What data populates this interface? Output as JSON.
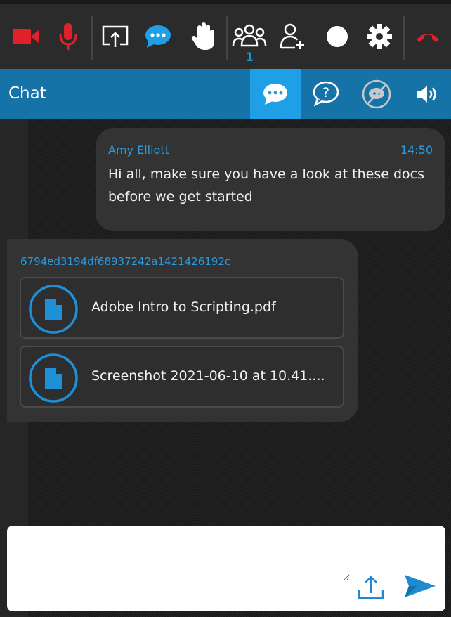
{
  "toolbar": {
    "participant_count": "1"
  },
  "chat_header": {
    "title": "Chat"
  },
  "messages": [
    {
      "sender": "Amy Elliott",
      "time": "14:50",
      "text": "Hi all, make sure you have a look at these docs before we get started"
    },
    {
      "sender": "6794ed3194df68937242a1421426192c",
      "files": [
        {
          "name": "Adobe Intro to Scripting.pdf"
        },
        {
          "name": "Screenshot 2021-06-10 at 10.41...."
        }
      ]
    }
  ],
  "composer": {
    "placeholder": ""
  },
  "colors": {
    "accent": "#1e9fe6",
    "header": "#1573a8",
    "danger": "#e0202a"
  },
  "icons": [
    "camera-icon",
    "microphone-icon",
    "screen-share-icon",
    "chat-icon",
    "raise-hand-icon",
    "participants-icon",
    "add-user-icon",
    "record-icon",
    "gear-icon",
    "hang-up-icon",
    "question-icon",
    "hide-icon",
    "speaker-icon",
    "file-icon",
    "upload-icon",
    "send-icon"
  ]
}
